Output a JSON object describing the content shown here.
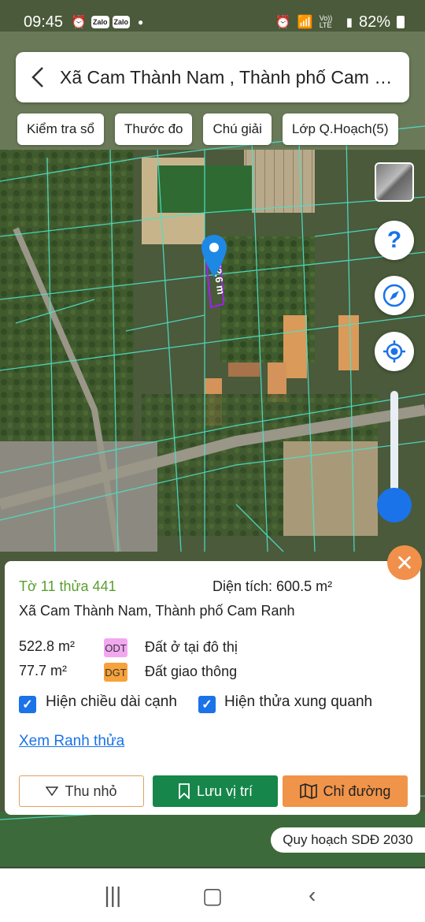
{
  "status_bar": {
    "time": "09:45",
    "notif_icons": [
      "alarm-icon",
      "zalo-icon",
      "zalo-icon"
    ],
    "zalo_text": "Zalo",
    "network": "Vo)) LTE",
    "battery": "82%"
  },
  "header": {
    "title": "Xã Cam Thành Nam , Thành phố Cam Ranh"
  },
  "toolbar": {
    "chips": [
      "Kiểm tra sổ",
      "Thước đo",
      "Chú giải",
      "Lớp Q.Hoạch(5)"
    ]
  },
  "map": {
    "measure_label": "52.6 m",
    "help_glyph": "?"
  },
  "parcel": {
    "sheet_parcel": "Tờ 11 thửa 441",
    "area_label": "Diện tích: 600.5 m²",
    "address": "Xã Cam Thành Nam, Thành phố Cam Ranh",
    "land_uses": [
      {
        "area": "522.8 m²",
        "code": "ODT",
        "name": "Đất ở tại đô thị",
        "color": "#f2a8f0"
      },
      {
        "area": "77.7 m²",
        "code": "DGT",
        "name": "Đất giao thông",
        "color": "#f7a23a"
      }
    ],
    "options": [
      {
        "label": "Hiện chiều dài cạnh",
        "checked": true
      },
      {
        "label": "Hiện thửa xung quanh",
        "checked": true
      }
    ],
    "boundary_link": "Xem Ranh thửa",
    "buttons": {
      "collapse": "Thu nhỏ",
      "save": "Lưu vị trí",
      "route": "Chỉ đường"
    }
  },
  "plan_layer": "Quy hoạch SDĐ 2030",
  "colors": {
    "accent_blue": "#1a73e8",
    "save_green": "#16864a",
    "route_orange": "#f0944a",
    "parcel_label_green": "#5a9e2f"
  }
}
